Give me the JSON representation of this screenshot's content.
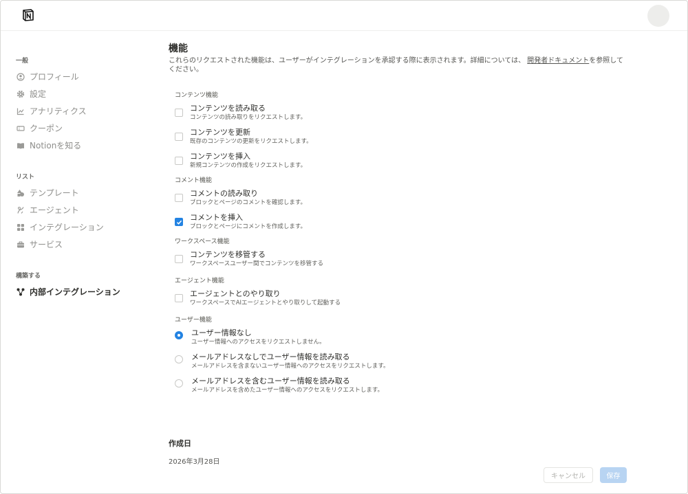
{
  "sidebar": {
    "sections": [
      {
        "title": "一般",
        "items": [
          {
            "label": "プロフィール",
            "icon": "user-circle-icon"
          },
          {
            "label": "設定",
            "icon": "gear-icon"
          },
          {
            "label": "アナリティクス",
            "icon": "chart-icon"
          },
          {
            "label": "クーポン",
            "icon": "ticket-icon"
          },
          {
            "label": "Notionを知る",
            "icon": "book-icon"
          }
        ]
      },
      {
        "title": "リスト",
        "items": [
          {
            "label": "テンプレート",
            "icon": "shapes-icon"
          },
          {
            "label": "エージェント",
            "icon": "agent-icon"
          },
          {
            "label": "インテグレーション",
            "icon": "grid-icon"
          },
          {
            "label": "サービス",
            "icon": "briefcase-icon"
          }
        ]
      },
      {
        "title": "構築する",
        "items": [
          {
            "label": "内部インテグレーション",
            "icon": "nodes-icon",
            "active": true
          }
        ]
      }
    ]
  },
  "main": {
    "title": "機能",
    "description_before": "これらのリクエストされた機能は、ユーザーがインテグレーションを承認する際に表示されます。詳細については、",
    "description_link": "開発者ドキュメント",
    "description_after": "を参照してください。",
    "groups": [
      {
        "title": "コンテンツ機能",
        "type": "checkbox",
        "options": [
          {
            "label": "コンテンツを読み取る",
            "sub": "コンテンツの読み取りをリクエストします。",
            "checked": false
          },
          {
            "label": "コンテンツを更新",
            "sub": "既存のコンテンツの更新をリクエストします。",
            "checked": false
          },
          {
            "label": "コンテンツを挿入",
            "sub": "新規コンテンツの作成をリクエストします。",
            "checked": false
          }
        ]
      },
      {
        "title": "コメント機能",
        "type": "checkbox",
        "options": [
          {
            "label": "コメントの読み取り",
            "sub": "ブロックとページのコメントを確認します。",
            "checked": false
          },
          {
            "label": "コメントを挿入",
            "sub": "ブロックとページにコメントを作成します。",
            "checked": true
          }
        ]
      },
      {
        "title": "ワークスペース機能",
        "type": "checkbox",
        "options": [
          {
            "label": "コンテンツを移管する",
            "sub": "ワークスペースユーザー間でコンテンツを移管する",
            "checked": false
          }
        ]
      },
      {
        "title": "エージェント機能",
        "type": "checkbox",
        "options": [
          {
            "label": "エージェントとのやり取り",
            "sub": "ワークスペースでAIエージェントとやり取りして起動する",
            "checked": false
          }
        ]
      },
      {
        "title": "ユーザー機能",
        "type": "radio",
        "options": [
          {
            "label": "ユーザー情報なし",
            "sub": "ユーザー情報へのアクセスをリクエストしません。",
            "checked": true
          },
          {
            "label": "メールアドレスなしでユーザー情報を読み取る",
            "sub": "メールアドレスを含まないユーザー情報へのアクセスをリクエストします。",
            "checked": false
          },
          {
            "label": "メールアドレスを含むユーザー情報を読み取る",
            "sub": "メールアドレスを含めたユーザー情報へのアクセスをリクエストします。",
            "checked": false
          }
        ]
      }
    ]
  },
  "created": {
    "label": "作成日",
    "value": "2026年3月28日"
  },
  "footer": {
    "cancel_label": "キャンセル",
    "save_label": "保存"
  },
  "colors": {
    "accent": "#2383e2",
    "save_disabled": "#b8d4f2"
  }
}
